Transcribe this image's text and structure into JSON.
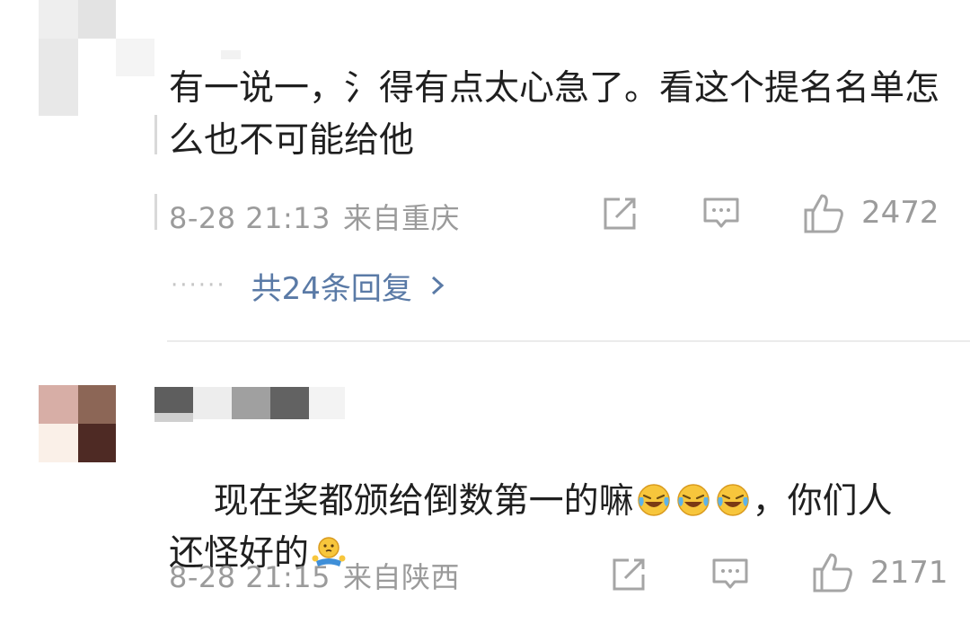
{
  "comments": [
    {
      "text": "有一说一，氵得有点太心急了。看这个提名名单怎么也不可能给他",
      "date": "8-28 21:13",
      "location": "来自重庆",
      "likes": "2472",
      "replies_link": "共24条回复",
      "avatar_colors": [
        "#eeeeee",
        "#e3e3e3",
        "#f4f4f4",
        "#e8e8e8"
      ]
    },
    {
      "text_part1": "现在奖都颁给倒数第一的嘛",
      "text_part2": "，你们人",
      "text_line2": "还怪好的",
      "date": "8-28 21:15",
      "location": "来自陕西",
      "likes": "2171",
      "avatar_colors": [
        "#d7aea6",
        "#8c6656",
        "#faf0e8",
        "#4e2a24"
      ],
      "name_block_colors": [
        "#5e5e5e",
        "#a0a0a0",
        "#626262",
        "#d2d2d2",
        "#cfcfcf"
      ]
    }
  ],
  "icons": {
    "share": "share-icon",
    "comment": "comment-icon",
    "like": "thumbs-up-icon",
    "chevron": "chevron-right-icon",
    "laugh_cry": "laughing-crying-emoji",
    "shrug": "shrug-emoji"
  },
  "colors": {
    "link": "#5a7aa6",
    "meta": "#9b9b9b",
    "text": "#1f1f1f"
  }
}
